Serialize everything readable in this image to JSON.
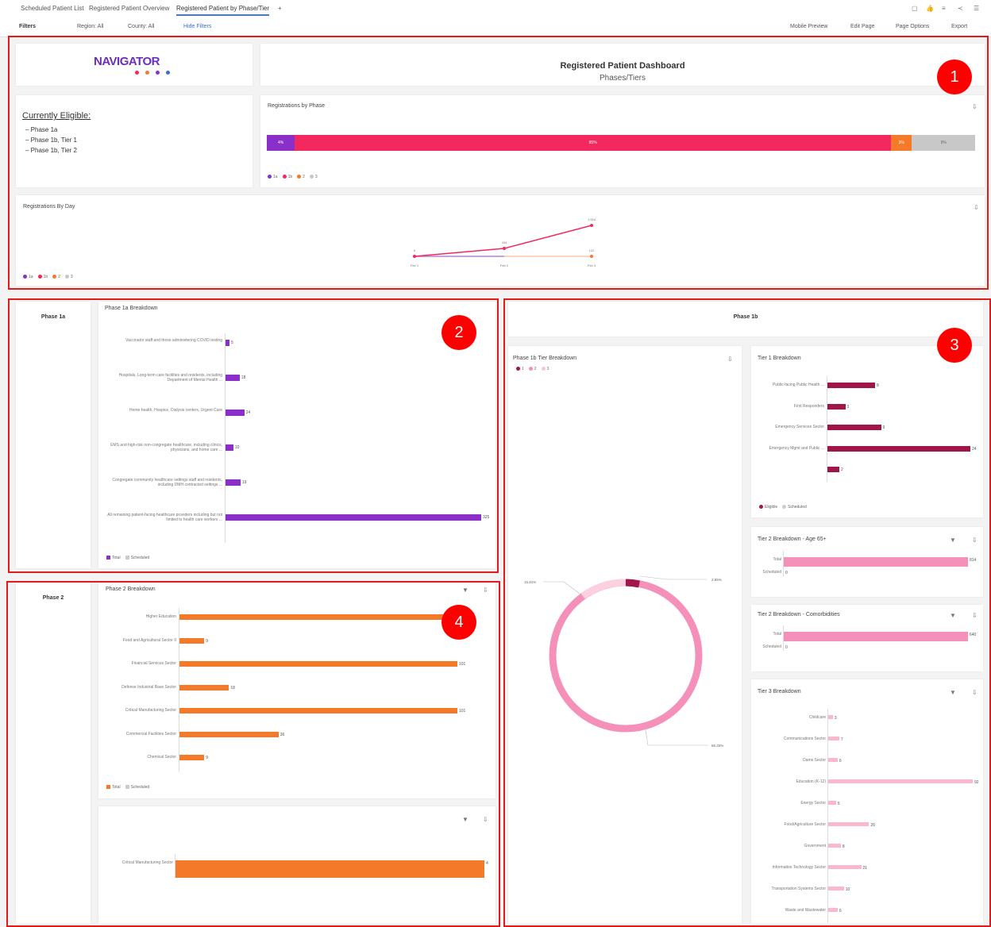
{
  "tabs": [
    "Scheduled Patient List",
    "Registered Patient Overview",
    "Registered Patient by Phase/Tier",
    "+"
  ],
  "toolbar": {
    "filters": "Filters",
    "region": "Region: All",
    "county": "County: All",
    "hide_filters": "Hide Filters",
    "mobile_preview": "Mobile Preview",
    "edit_page": "Edit Page",
    "page_options": "Page Options",
    "export": "Export"
  },
  "logo": {
    "text": "NAVIGATOR"
  },
  "header": {
    "title": "Registered Patient Dashboard",
    "subtitle": "Phases/Tiers"
  },
  "eligible": {
    "heading": "Currently Eligible:",
    "items": [
      "Phase 1a",
      "Phase 1b, Tier 1",
      "Phase 1b, Tier 2"
    ]
  },
  "by_phase": {
    "title": "Registrations by Phase",
    "segments": [
      {
        "label": "4%",
        "value": 4,
        "color": "#8a2fc8"
      },
      {
        "label": "85%",
        "value": 85,
        "color": "#f2285e"
      },
      {
        "label": "3%",
        "value": 3,
        "color": "#f47a2a"
      },
      {
        "label": "9%",
        "value": 9,
        "color": "#c8c8c8"
      }
    ],
    "legend": [
      "1a",
      "1b",
      "2",
      "3"
    ]
  },
  "by_day": {
    "title": "Registrations By Day",
    "x": [
      "Feb 1",
      "Feb 2",
      "Feb 3"
    ],
    "labels": [
      "0",
      "434",
      "1,004",
      "122"
    ],
    "legend": [
      "1a",
      "1b",
      "2",
      "3"
    ]
  },
  "phase1a": {
    "label": "Phase 1a",
    "title": "Phase 1a Breakdown",
    "rows": [
      {
        "label": "Vaccinator staff and those administering COVID testing",
        "value": 5
      },
      {
        "label": "Hospitals, Long-term care facilities and residents, including Department of Mental Health ...",
        "value": 18
      },
      {
        "label": "Home health, Hospice, Dialysis centers, Urgent Care",
        "value": 24
      },
      {
        "label": "EMS and high-risk non-congregate healthcare, including clinics, physicians, and home care ...",
        "value": 10
      },
      {
        "label": "Congregate community healthcare settings staff and residents, including DMH contracted settings ...",
        "value": 19
      },
      {
        "label": "All remaining patient-facing healthcare providers including but not limited to health care workers ...",
        "value": 325
      }
    ],
    "legend": [
      "Total",
      "Scheduled"
    ]
  },
  "phase1b": {
    "label": "Phase 1b",
    "donut_title": "Phase 1b Tier Breakdown",
    "donut_legend": [
      "1",
      "2",
      "3"
    ],
    "donut_labels": [
      "15.81%",
      "2.85%",
      "85.33%"
    ],
    "tier1": {
      "title": "Tier 1 Breakdown",
      "rows": [
        {
          "label": "Public-facing Public Health ...",
          "value": 8
        },
        {
          "label": "First Responders",
          "value": 3
        },
        {
          "label": "Emergency Services Sector",
          "value": 9
        },
        {
          "label": "Emergency Mgmt and Public ...",
          "value": 24
        },
        {
          "label": "",
          "value": 2
        }
      ],
      "legend": [
        "Eligible",
        "Scheduled"
      ]
    },
    "tier2_age": {
      "title": "Tier 2 Breakdown - Age 65+",
      "rows": [
        {
          "label": "Total",
          "value": 814
        },
        {
          "label": "Scheduled",
          "value": 0
        }
      ]
    },
    "tier2_comorb": {
      "title": "Tier 2 Breakdown - Comorbidities",
      "rows": [
        {
          "label": "Total",
          "value": 640
        },
        {
          "label": "Scheduled",
          "value": 0
        }
      ]
    },
    "tier3": {
      "title": "Tier 3 Breakdown",
      "rows": [
        {
          "label": "Childcare",
          "value": 3
        },
        {
          "label": "Communications Sector",
          "value": 7
        },
        {
          "label": "Dams Sector",
          "value": 6
        },
        {
          "label": "Education (K-12)",
          "value": 92
        },
        {
          "label": "Energy Sector",
          "value": 5
        },
        {
          "label": "Food/Agriculture Sector",
          "value": 26
        },
        {
          "label": "Government",
          "value": 8
        },
        {
          "label": "Information Technology Sector",
          "value": 21
        },
        {
          "label": "Transportation Systems Sector",
          "value": 10
        },
        {
          "label": "Waste and Wastewater",
          "value": 6
        }
      ]
    }
  },
  "phase2": {
    "label": "Phase 2",
    "title": "Phase 2 Breakdown",
    "rows": [
      {
        "label": "Higher Education",
        "value": 100
      },
      {
        "label": "Food and Agricultural Sector II",
        "value": 9
      },
      {
        "label": "Financial Services Sector",
        "value": 101
      },
      {
        "label": "Defense Industrial Base Sector",
        "value": 18
      },
      {
        "label": "Critical Manufacturing Sector",
        "value": 101
      },
      {
        "label": "Commercial Facilities Sector",
        "value": 36
      },
      {
        "label": "Chemical Sector",
        "value": 9
      }
    ],
    "legend": [
      "Total",
      "Scheduled"
    ],
    "sub_rows": [
      {
        "label": "Critical Manufacturing Sector",
        "value": 4
      }
    ]
  },
  "badges": [
    "1",
    "2",
    "3",
    "4"
  ]
}
